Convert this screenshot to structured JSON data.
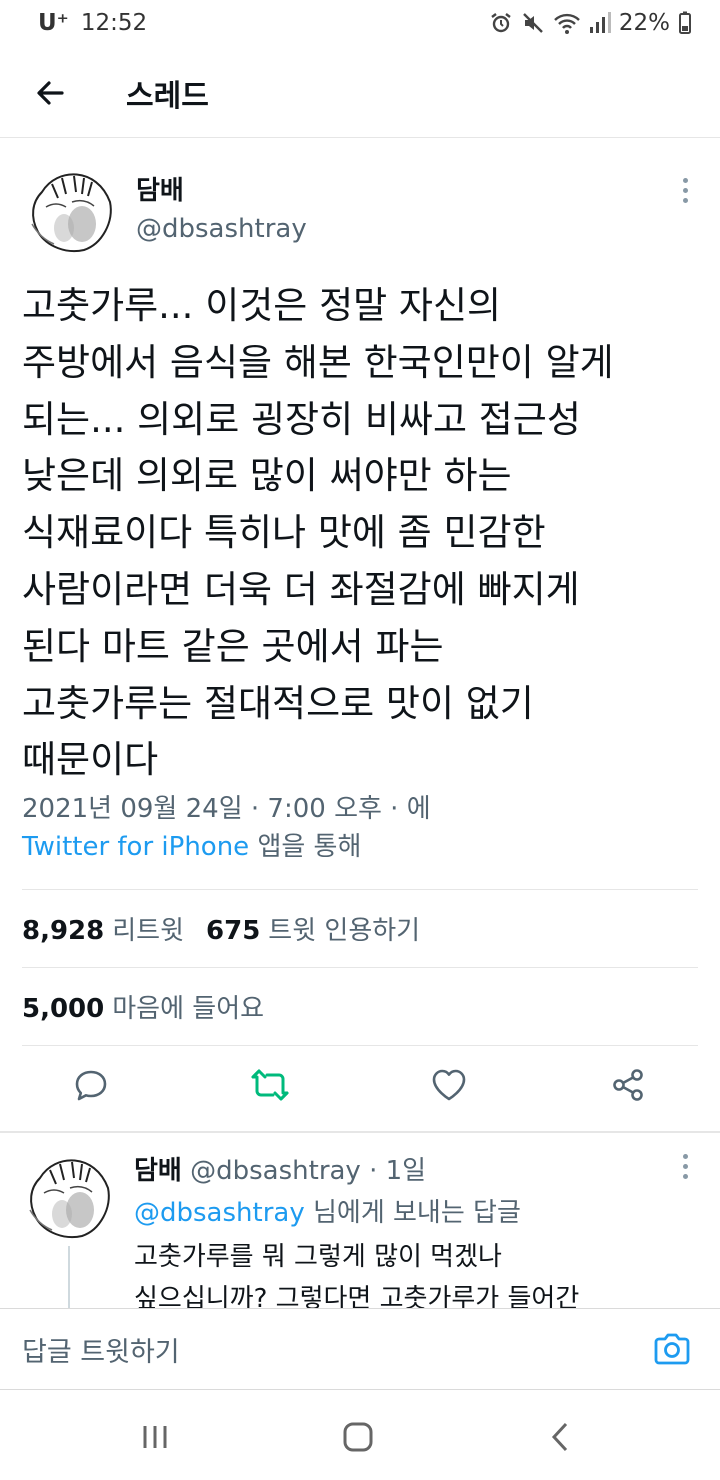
{
  "status_bar": {
    "carrier": "U⁺",
    "time": "12:52",
    "battery": "22%"
  },
  "header": {
    "title": "스레드"
  },
  "tweet": {
    "author_name": "담배",
    "author_handle": "@dbsashtray",
    "text_lines": [
      "고춧가루... 이것은 정말 자신의",
      "주방에서 음식을 해본 한국인만이 알게",
      "되는... 의외로 굉장히 비싸고 접근성",
      "낮은데 의외로 많이 써야만 하는",
      "식재료이다 특히나 맛에 좀 민감한",
      "사람이라면 더욱 더 좌절감에 빠지게",
      "된다 마트 같은 곳에서 파는",
      "고춧가루는 절대적으로 맛이 없기",
      "때문이다"
    ],
    "timestamp": "2021년 09월 24일 · 7:00 오후 · 에",
    "source": "Twitter for iPhone",
    "source_suffix": " 앱을 통해",
    "retweets_count": "8,928",
    "retweets_label": "리트윗",
    "quotes_count": "675",
    "quotes_label": "트윗 인용하기",
    "likes_count": "5,000",
    "likes_label": "마음에 들어요"
  },
  "reply": {
    "author_name": "담배",
    "author_handle": "@dbsashtray",
    "age": "· 1일",
    "mention": "@dbsashtray",
    "reply_to_suffix": " 님에게 보내는 답글",
    "text_lines": [
      "고춧가루를 뭐 그렇게 많이 먹겠나",
      "싶으십니까? 그렇다면 고춧가루가 들어간"
    ]
  },
  "compose": {
    "placeholder": "답글 트윗하기"
  },
  "colors": {
    "accent": "#1d9bf0",
    "retweet_active": "#00ba7c",
    "secondary_text": "#536471",
    "primary_text": "#0f1419"
  },
  "icons": {
    "back": "back-arrow-icon",
    "more": "more-vertical-icon",
    "reply": "reply-icon",
    "retweet": "retweet-icon",
    "like": "heart-icon",
    "share": "share-icon",
    "camera": "camera-icon"
  }
}
